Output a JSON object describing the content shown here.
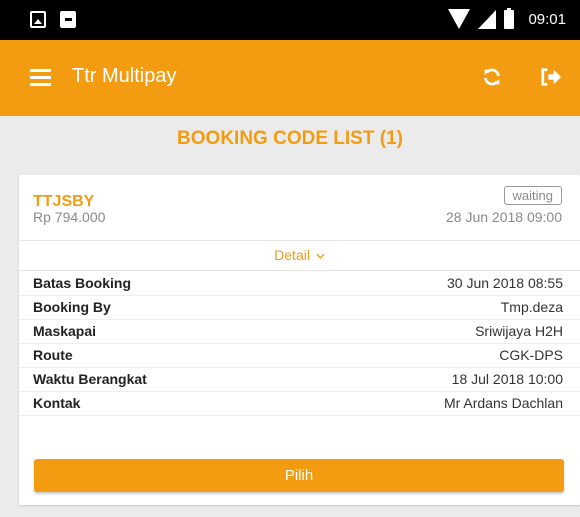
{
  "status_bar": {
    "time": "09:01",
    "left_icons": [
      "photo-icon",
      "game-icon"
    ],
    "right_icons": [
      "wifi-icon",
      "signal-icon",
      "battery-icon"
    ]
  },
  "app_bar": {
    "title": "Ttr Multipay",
    "menu_icon": "hamburger-icon",
    "refresh_icon": "refresh-icon",
    "logout_icon": "logout-icon",
    "color": "#f39c12"
  },
  "page": {
    "heading": "BOOKING CODE LIST (1)"
  },
  "booking": {
    "code": "TTJSBY",
    "price": "Rp 794.000",
    "status": "waiting",
    "created": "28 Jun 2018  09:00",
    "detail_label": "Detail",
    "details": [
      {
        "label": "Batas Booking",
        "value": "30 Jun 2018  08:55"
      },
      {
        "label": "Booking By",
        "value": "Tmp.deza"
      },
      {
        "label": "Maskapai",
        "value": "Sriwijaya H2H"
      },
      {
        "label": "Route",
        "value": "CGK-DPS"
      },
      {
        "label": "Waktu Berangkat",
        "value": "18 Jul 2018  10:00"
      },
      {
        "label": "Kontak",
        "value": "Mr  Ardans  Dachlan"
      }
    ],
    "select_label": "Pilih"
  }
}
